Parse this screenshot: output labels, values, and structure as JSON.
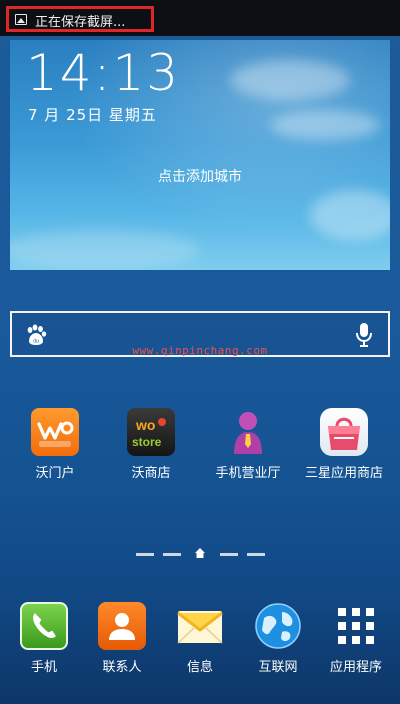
{
  "status": {
    "notification_text": "正在保存截屏..."
  },
  "widget": {
    "time": "14:13",
    "date": "7 月 25日 星期五",
    "city_prompt": "点击添加城市"
  },
  "search": {
    "watermark": "www.qinpinchang.com"
  },
  "apps": [
    {
      "label": "沃门户"
    },
    {
      "label": "沃商店"
    },
    {
      "label": "手机营业厅"
    },
    {
      "label": "三星应用商店"
    }
  ],
  "dock": [
    {
      "label": "手机"
    },
    {
      "label": "联系人"
    },
    {
      "label": "信息"
    },
    {
      "label": "互联网"
    },
    {
      "label": "应用程序"
    }
  ],
  "icons": {
    "notification": "image-icon",
    "search_logo": "baidu-paw-icon",
    "voice": "microphone-icon",
    "home": "home-icon"
  }
}
